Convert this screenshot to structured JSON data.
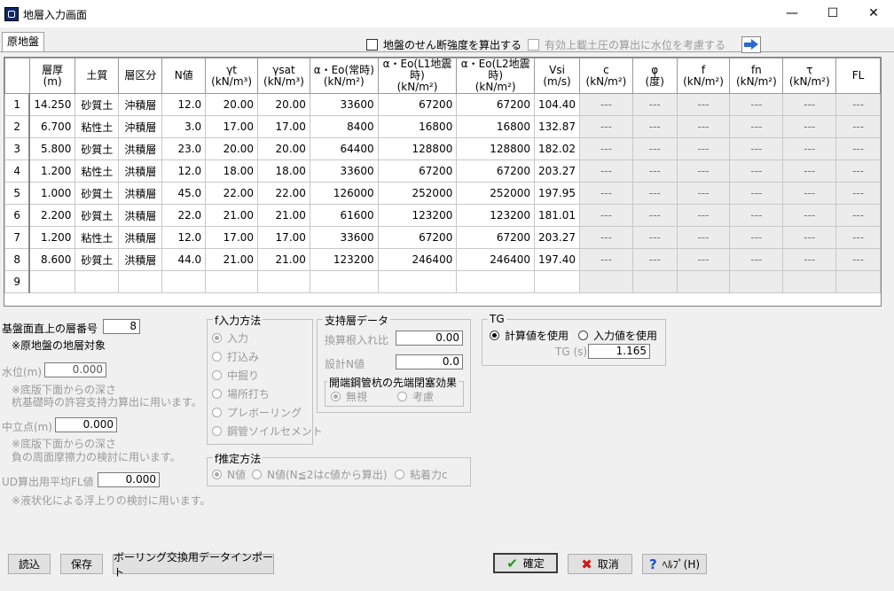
{
  "window": {
    "title": "地層入力画面"
  },
  "tabs": [
    {
      "label": "原地盤"
    }
  ],
  "options": {
    "shear_strength": "地盤のせん断強度を算出する",
    "water_level": "有効上載土圧の算出に水位を考慮する"
  },
  "grid": {
    "headers": [
      {
        "l1": "",
        "l2": ""
      },
      {
        "l1": "層厚",
        "l2": "(m)"
      },
      {
        "l1": "土質",
        "l2": ""
      },
      {
        "l1": "層区分",
        "l2": ""
      },
      {
        "l1": "N値",
        "l2": ""
      },
      {
        "l1": "γt",
        "l2": "(kN/m³)"
      },
      {
        "l1": "γsat",
        "l2": "(kN/m³)"
      },
      {
        "l1": "α・Eo(常時)",
        "l2": "(kN/m²)"
      },
      {
        "l1": "α・Eo(L1地震時)",
        "l2": "(kN/m²)"
      },
      {
        "l1": "α・Eo(L2地震時)",
        "l2": "(kN/m²)"
      },
      {
        "l1": "Vsi",
        "l2": "(m/s)"
      },
      {
        "l1": "c",
        "l2": "(kN/m²)"
      },
      {
        "l1": "φ",
        "l2": "(度)"
      },
      {
        "l1": "f",
        "l2": "(kN/m²)"
      },
      {
        "l1": "fn",
        "l2": "(kN/m²)"
      },
      {
        "l1": "τ",
        "l2": "(kN/m²)"
      },
      {
        "l1": "FL",
        "l2": ""
      }
    ],
    "rows": [
      [
        "1",
        "14.250",
        "砂質土",
        "沖積層",
        "12.0",
        "20.00",
        "20.00",
        "33600",
        "67200",
        "67200",
        "104.40",
        "---",
        "---",
        "---",
        "---",
        "---",
        "---"
      ],
      [
        "2",
        "6.700",
        "粘性土",
        "沖積層",
        "3.0",
        "17.00",
        "17.00",
        "8400",
        "16800",
        "16800",
        "132.87",
        "---",
        "---",
        "---",
        "---",
        "---",
        "---"
      ],
      [
        "3",
        "5.800",
        "砂質土",
        "洪積層",
        "23.0",
        "20.00",
        "20.00",
        "64400",
        "128800",
        "128800",
        "182.02",
        "---",
        "---",
        "---",
        "---",
        "---",
        "---"
      ],
      [
        "4",
        "1.200",
        "粘性土",
        "洪積層",
        "12.0",
        "18.00",
        "18.00",
        "33600",
        "67200",
        "67200",
        "203.27",
        "---",
        "---",
        "---",
        "---",
        "---",
        "---"
      ],
      [
        "5",
        "1.000",
        "砂質土",
        "洪積層",
        "45.0",
        "22.00",
        "22.00",
        "126000",
        "252000",
        "252000",
        "197.95",
        "---",
        "---",
        "---",
        "---",
        "---",
        "---"
      ],
      [
        "6",
        "2.200",
        "砂質土",
        "洪積層",
        "22.0",
        "21.00",
        "21.00",
        "61600",
        "123200",
        "123200",
        "181.01",
        "---",
        "---",
        "---",
        "---",
        "---",
        "---"
      ],
      [
        "7",
        "1.200",
        "粘性土",
        "洪積層",
        "12.0",
        "17.00",
        "17.00",
        "33600",
        "67200",
        "67200",
        "203.27",
        "---",
        "---",
        "---",
        "---",
        "---",
        "---"
      ],
      [
        "8",
        "8.600",
        "砂質土",
        "洪積層",
        "44.0",
        "21.00",
        "21.00",
        "123200",
        "246400",
        "246400",
        "197.40",
        "---",
        "---",
        "---",
        "---",
        "---",
        "---"
      ],
      [
        "9",
        "",
        "",
        "",
        "",
        "",
        "",
        "",
        "",
        "",
        "",
        "",
        "",
        "",
        "",
        "",
        ""
      ]
    ]
  },
  "lower": {
    "base_layer_label": "基盤面直上の層番号",
    "base_layer_value": "8",
    "base_layer_note": "※原地盤の地層対象",
    "water_label": "水位(m)",
    "water_value": "0.000",
    "water_note1": "※底版下面からの深さ",
    "water_note2": "杭基礎時の許容支持力算出に用います。",
    "neutral_label": "中立点(m)",
    "neutral_value": "0.000",
    "neutral_note1": "※底版下面からの深さ",
    "neutral_note2": "負の周面摩擦力の検討に用います。",
    "ud_label": "UD算出用平均FL値",
    "ud_value": "0.000",
    "ud_note": "※液状化による浮上りの検討に用います。"
  },
  "f_input": {
    "caption": "f入力方法",
    "options": [
      "入力",
      "打込み",
      "中掘り",
      "場所打ち",
      "プレボーリング",
      "鋼管ソイルセメント"
    ]
  },
  "support": {
    "caption": "支持層データ",
    "ratio_label": "換算根入れ比",
    "ratio_value": "0.00",
    "n_label": "設計N値",
    "n_value": "0.0",
    "pipe_caption": "開端鋼管杭の先端閉塞効果",
    "pipe_options": [
      "無視",
      "考慮"
    ]
  },
  "tg": {
    "caption": "TG",
    "options": [
      "計算値を使用",
      "入力値を使用"
    ],
    "value_label": "TG (s)",
    "value": "1.165"
  },
  "estimate": {
    "caption": "f推定方法",
    "options": [
      "N値",
      "N値(N≦2はc値から算出)",
      "粘着力c"
    ]
  },
  "buttons": {
    "load": "読込",
    "save": "保存",
    "import": "ボーリング交換用データインポート",
    "ok": "確定",
    "cancel": "取消",
    "help": "ﾍﾙﾌﾟ(H)"
  }
}
